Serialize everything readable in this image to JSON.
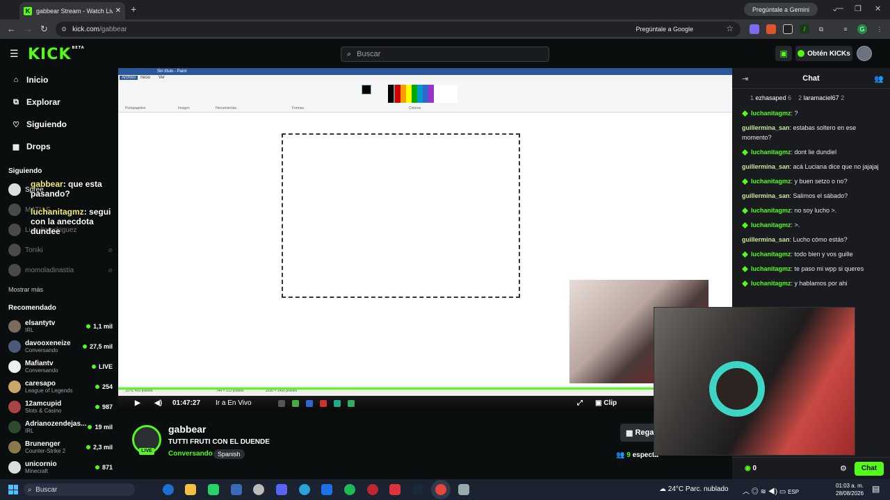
{
  "browser": {
    "tab_title": "gabbear Stream - Watch Live o",
    "tab_favicon": "K",
    "new_tab": "+",
    "gemini": "Pregúntale a Gemini",
    "url_host": "kick.com",
    "url_path": "/gabbear",
    "ask_google": "Pregúntale a Google"
  },
  "kick": {
    "search_placeholder": "Buscar",
    "kicks_button": "Obtén KICKs",
    "logo_sup": "BETA"
  },
  "sidebar": {
    "nav": [
      {
        "label": "Inicio",
        "icon": "home-icon"
      },
      {
        "label": "Explorar",
        "icon": "compass-icon"
      },
      {
        "label": "Siguiendo",
        "icon": "heart-icon"
      },
      {
        "label": "Drops",
        "icon": "gift-icon"
      }
    ],
    "following_title": "Siguiendo",
    "following": [
      "Spree",
      "MATIAS",
      "Luquitarodriguez",
      "Toniki",
      "momoladinastia"
    ],
    "show_more": "Mostrar más",
    "recommended_title": "Recomendado",
    "recommended": [
      {
        "name": "elsantytv",
        "category": "IRL",
        "viewers": "1,1 mil",
        "color": "#7a6b5a"
      },
      {
        "name": "davooxeneize",
        "category": "Conversando",
        "viewers": "27,5 mil",
        "color": "#4a5a7a"
      },
      {
        "name": "Mafiantv",
        "category": "Conversando",
        "viewers": "LIVE",
        "color": "#eeeeee"
      },
      {
        "name": "caresapo",
        "category": "League of Legends",
        "viewers": "254",
        "color": "#c9a66b"
      },
      {
        "name": "12amcupid",
        "category": "Slots & Casino",
        "viewers": "987",
        "color": "#a44"
      },
      {
        "name": "Adrianozendejas...",
        "category": "IRL",
        "viewers": "19 mil",
        "color": "#2d4a2d"
      },
      {
        "name": "Brunenger",
        "category": "Counter-Strike 2",
        "viewers": "2,3 mil",
        "color": "#8a7a4a"
      },
      {
        "name": "unicornio",
        "category": "Minecraft",
        "viewers": "871",
        "color": "#ddd"
      }
    ],
    "overlay_msgs": [
      {
        "user": "gabbear",
        "text": ": que esta pasando?"
      },
      {
        "user": "luchanitagmz",
        "text": ": segui con la anecdota dundee"
      }
    ]
  },
  "video": {
    "paint_title": "Sin título - Paint",
    "paint_tabs": [
      "Archivo",
      "Inicio",
      "Ver"
    ],
    "paint_groups": [
      "Portapapeles",
      "Imagen",
      "Herramientas",
      "Formas",
      "Colores"
    ],
    "paint_status": [
      "1076, 400 píxeles",
      "744 × 312 píxeles",
      "2930 × 1490 píxeles"
    ],
    "time": "01:47:27",
    "go_live": "Ir a En Vivo",
    "clip": "Clip"
  },
  "stream": {
    "channel": "gabbear",
    "title": "TUTTI FRUTI CON EL DUENDE",
    "category": "Conversando",
    "language": "Spanish",
    "live": "LIVE",
    "gift_button": "Rega",
    "viewers_count": "9",
    "viewers_label": "especta"
  },
  "chat": {
    "title": "Chat",
    "leaders": [
      {
        "rank": "1",
        "name": "ezhasaped",
        "count": "6"
      },
      {
        "rank": "2",
        "name": "laramaciel67",
        "count": "2"
      }
    ],
    "messages": [
      {
        "user": "luchanitagmz",
        "badge": true,
        "text": ": ?"
      },
      {
        "user": "guillermina_san",
        "badge": false,
        "text": ": estabas soltero en ese momento?"
      },
      {
        "user": "luchanitagmz",
        "badge": true,
        "text": ": dont lie dundiel"
      },
      {
        "user": "guillermina_san",
        "badge": false,
        "text": ": acá Luciana dice que no jajajaj"
      },
      {
        "user": "luchanitagmz",
        "badge": true,
        "text": ": y buen setzo o no?"
      },
      {
        "user": "guillermina_san",
        "badge": false,
        "text": ": Salimos el sábado?"
      },
      {
        "user": "luchanitagmz",
        "badge": true,
        "text": ": no soy lucho >."
      },
      {
        "user": "luchanitagmz",
        "badge": true,
        "text": ": >."
      },
      {
        "user": "guillermina_san",
        "badge": false,
        "text": ": Lucho cómo estás?"
      },
      {
        "user": "luchanitagmz",
        "badge": true,
        "text": ": todo bien y vos guille"
      },
      {
        "user": "luchanitagmz",
        "badge": true,
        "text": ": te paso mi wpp si queres"
      },
      {
        "user": "luchanitagmz",
        "badge": true,
        "text": ": y hablamos por ahi"
      }
    ],
    "kicks_count": "0",
    "send_label": "Chat"
  },
  "taskbar": {
    "search": "Buscar",
    "weather": "24°C  Parc. nublado",
    "lang": "ESP",
    "time": "01:03 a. m.",
    "date": "28/08/2026"
  }
}
